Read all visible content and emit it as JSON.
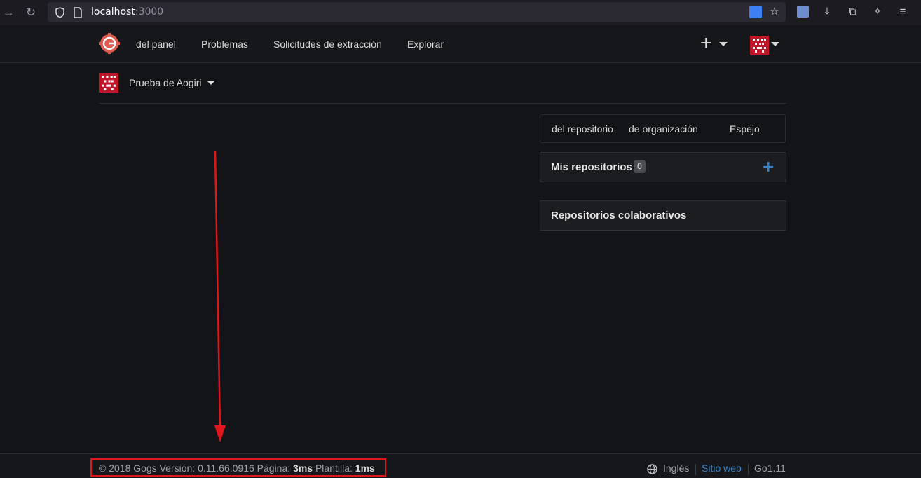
{
  "browser": {
    "url_host": "localhost",
    "url_port": ":3000"
  },
  "header": {
    "nav": [
      "del panel",
      "Problemas",
      "Solicitudes de extracción",
      "Explorar"
    ],
    "plus": "+"
  },
  "context": {
    "org_name": "Prueba de Aogiri"
  },
  "repo_panel": {
    "tabs": [
      "del repositorio",
      "de organización",
      "Espejo"
    ],
    "my_repos_title": "Mis repositorios",
    "my_repos_count": "0",
    "add_symbol": "+",
    "collab_title": "Repositorios colaborativos"
  },
  "footer": {
    "copyright": "© 2018 Gogs Versión: 0.11.66.0916 Página: ",
    "page_time": "3ms",
    "template_label": " Plantilla: ",
    "template_time": "1ms",
    "language": "Inglés",
    "website": "Sitio web",
    "go_version": "Go1.11"
  },
  "colors": {
    "accent_red": "#e0161a",
    "link_blue": "#3b82c4",
    "brand_red": "#c0162a"
  }
}
